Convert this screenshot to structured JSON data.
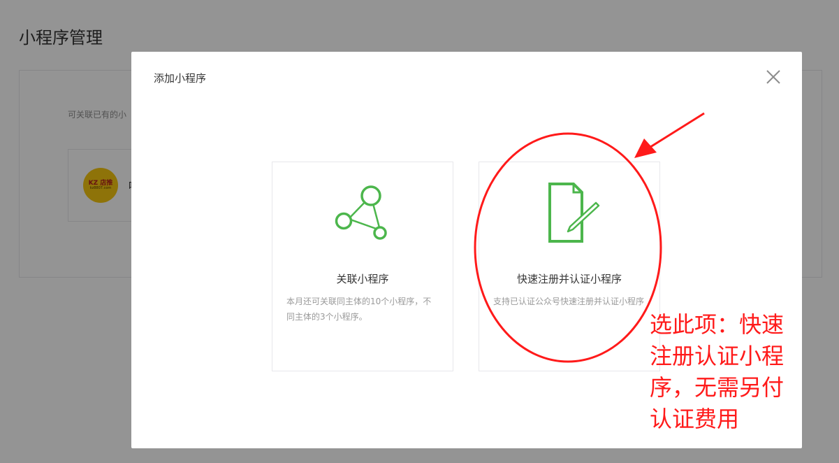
{
  "page": {
    "title": "小程序管理",
    "description": "可关联已有的小",
    "card_logo_text": "店推",
    "card_logo_prefix": "KZ",
    "card_logo_sub": "kz8807.com",
    "card_name": "啡"
  },
  "dialog": {
    "title": "添加小程序",
    "options": [
      {
        "label": "关联小程序",
        "description": "本月还可关联同主体的10个小程序，不同主体的3个小程序。",
        "icon": "network-nodes-icon"
      },
      {
        "label": "快速注册并认证小程序",
        "description": "支持已认证公众号快速注册并认证小程序",
        "icon": "document-edit-icon"
      }
    ]
  },
  "annotation": {
    "text": "选此项：快速注册认证小程序，无需另付认证费用",
    "color": "#ff1a1a"
  },
  "colors": {
    "accent_green": "#4cb64c",
    "overlay": "rgba(0,0,0,0.42)"
  }
}
